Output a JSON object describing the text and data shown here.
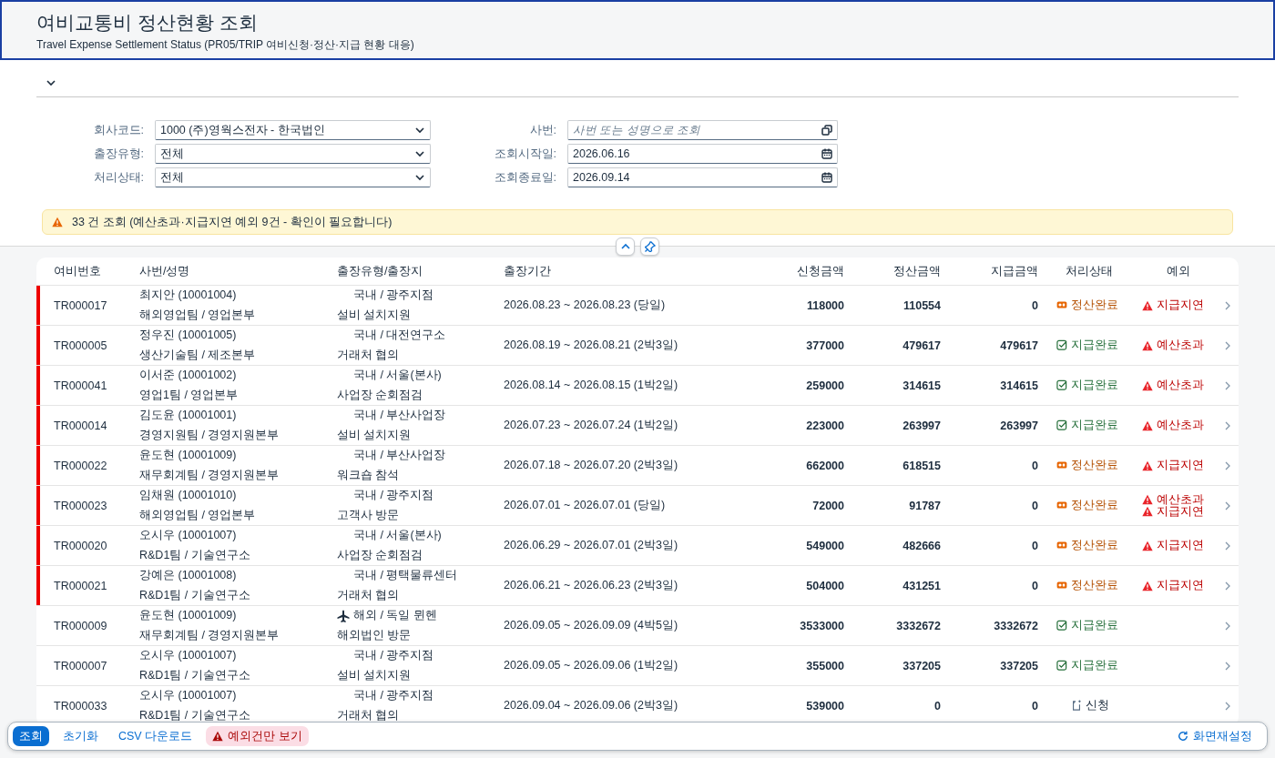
{
  "header": {
    "title": "여비교통비 정산현황 조회",
    "subtitle": "Travel Expense Settlement Status (PR05/TRIP 여비신청·정산·지급 현황 대응)"
  },
  "filter_bar": {
    "expanded": true
  },
  "filters": [
    {
      "label": "회사코드:",
      "value": "1000 (주)영웍스전자 - 한국법인",
      "kind": "select"
    },
    {
      "label": "사번:",
      "placeholder": "사번 또는 성명으로 조회",
      "kind": "valuehelp"
    },
    {
      "label": "출장유형:",
      "value": "전체",
      "kind": "select"
    },
    {
      "label": "조회시작일:",
      "value": "2026.06.16",
      "kind": "date"
    },
    {
      "label": "처리상태:",
      "value": "전체",
      "kind": "select"
    },
    {
      "label": "조회종료일:",
      "value": "2026.09.14",
      "kind": "date"
    }
  ],
  "message_strip": {
    "text": "33 건 조회 (예산초과·지급지연 예외 9건 - 확인이 필요합니다)"
  },
  "table": {
    "columns": [
      "여비번호",
      "사번/성명",
      "출장유형/출장지",
      "출장기간",
      "신청금액",
      "정산금액",
      "지급금액",
      "처리상태",
      "예외"
    ],
    "rows": [
      {
        "id": "TR000017",
        "person": "최지안 (10001004)",
        "org": "해외영업팀 / 영업본부",
        "overseas": false,
        "trip": "국내 / 광주지점",
        "purpose": "설비 설치지원",
        "period": "2026.08.23 ~ 2026.08.23 (당일)",
        "requested": "118000",
        "settled": "110554",
        "paid": "0",
        "status": {
          "kind": "settled",
          "label": "정산완료"
        },
        "exceptions": [
          "지급지연"
        ]
      },
      {
        "id": "TR000005",
        "person": "정우진 (10001005)",
        "org": "생산기술팀 / 제조본부",
        "overseas": false,
        "trip": "국내 / 대전연구소",
        "purpose": "거래처 협의",
        "period": "2026.08.19 ~ 2026.08.21 (2박3일)",
        "requested": "377000",
        "settled": "479617",
        "paid": "479617",
        "status": {
          "kind": "paid",
          "label": "지급완료"
        },
        "exceptions": [
          "예산초과"
        ]
      },
      {
        "id": "TR000041",
        "person": "이서준 (10001002)",
        "org": "영업1팀 / 영업본부",
        "overseas": false,
        "trip": "국내 / 서울(본사)",
        "purpose": "사업장 순회점검",
        "period": "2026.08.14 ~ 2026.08.15 (1박2일)",
        "requested": "259000",
        "settled": "314615",
        "paid": "314615",
        "status": {
          "kind": "paid",
          "label": "지급완료"
        },
        "exceptions": [
          "예산초과"
        ]
      },
      {
        "id": "TR000014",
        "person": "김도윤 (10001001)",
        "org": "경영지원팀 / 경영지원본부",
        "overseas": false,
        "trip": "국내 / 부산사업장",
        "purpose": "설비 설치지원",
        "period": "2026.07.23 ~ 2026.07.24 (1박2일)",
        "requested": "223000",
        "settled": "263997",
        "paid": "263997",
        "status": {
          "kind": "paid",
          "label": "지급완료"
        },
        "exceptions": [
          "예산초과"
        ]
      },
      {
        "id": "TR000022",
        "person": "윤도현 (10001009)",
        "org": "재무회계팀 / 경영지원본부",
        "overseas": false,
        "trip": "국내 / 부산사업장",
        "purpose": "워크숍 참석",
        "period": "2026.07.18 ~ 2026.07.20 (2박3일)",
        "requested": "662000",
        "settled": "618515",
        "paid": "0",
        "status": {
          "kind": "settled",
          "label": "정산완료"
        },
        "exceptions": [
          "지급지연"
        ]
      },
      {
        "id": "TR000023",
        "person": "임채원 (10001010)",
        "org": "해외영업팀 / 영업본부",
        "overseas": false,
        "trip": "국내 / 광주지점",
        "purpose": "고객사 방문",
        "period": "2026.07.01 ~ 2026.07.01 (당일)",
        "requested": "72000",
        "settled": "91787",
        "paid": "0",
        "status": {
          "kind": "settled",
          "label": "정산완료"
        },
        "exceptions": [
          "예산초과",
          "지급지연"
        ]
      },
      {
        "id": "TR000020",
        "person": "오시우 (10001007)",
        "org": "R&D1팀 / 기술연구소",
        "overseas": false,
        "trip": "국내 / 서울(본사)",
        "purpose": "사업장 순회점검",
        "period": "2026.06.29 ~ 2026.07.01 (2박3일)",
        "requested": "549000",
        "settled": "482666",
        "paid": "0",
        "status": {
          "kind": "settled",
          "label": "정산완료"
        },
        "exceptions": [
          "지급지연"
        ]
      },
      {
        "id": "TR000021",
        "person": "강예은 (10001008)",
        "org": "R&D1팀 / 기술연구소",
        "overseas": false,
        "trip": "국내 / 평택물류센터",
        "purpose": "거래처 협의",
        "period": "2026.06.21 ~ 2026.06.23 (2박3일)",
        "requested": "504000",
        "settled": "431251",
        "paid": "0",
        "status": {
          "kind": "settled",
          "label": "정산완료"
        },
        "exceptions": [
          "지급지연"
        ]
      },
      {
        "id": "TR000009",
        "person": "윤도현 (10001009)",
        "org": "재무회계팀 / 경영지원본부",
        "overseas": true,
        "trip": "해외 / 독일 뮌헨",
        "purpose": "해외법인 방문",
        "period": "2026.09.05 ~ 2026.09.09 (4박5일)",
        "requested": "3533000",
        "settled": "3332672",
        "paid": "3332672",
        "status": {
          "kind": "paid",
          "label": "지급완료"
        },
        "exceptions": []
      },
      {
        "id": "TR000007",
        "person": "오시우 (10001007)",
        "org": "R&D1팀 / 기술연구소",
        "overseas": false,
        "trip": "국내 / 광주지점",
        "purpose": "설비 설치지원",
        "period": "2026.09.05 ~ 2026.09.06 (1박2일)",
        "requested": "355000",
        "settled": "337205",
        "paid": "337205",
        "status": {
          "kind": "paid",
          "label": "지급완료"
        },
        "exceptions": []
      },
      {
        "id": "TR000033",
        "person": "오시우 (10001007)",
        "org": "R&D1팀 / 기술연구소",
        "overseas": false,
        "trip": "국내 / 광주지점",
        "purpose": "거래처 협의",
        "period": "2026.09.04 ~ 2026.09.06 (2박3일)",
        "requested": "539000",
        "settled": "0",
        "paid": "0",
        "status": {
          "kind": "requested",
          "label": "신청"
        },
        "exceptions": []
      }
    ]
  },
  "footer": {
    "buttons": [
      {
        "label": "조회",
        "kind": "primary"
      },
      {
        "label": "초기화",
        "kind": "link"
      },
      {
        "label": "CSV 다운로드",
        "kind": "link"
      },
      {
        "label": "예외건만 보기",
        "kind": "warning"
      }
    ],
    "reset": "화면재설정"
  }
}
